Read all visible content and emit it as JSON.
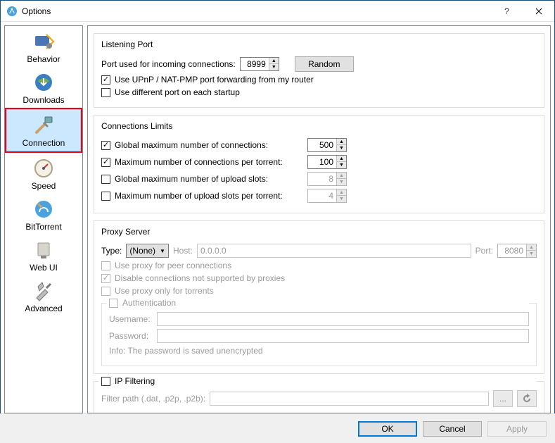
{
  "window": {
    "title": "Options"
  },
  "sidebar": {
    "items": [
      {
        "label": "Behavior"
      },
      {
        "label": "Downloads"
      },
      {
        "label": "Connection"
      },
      {
        "label": "Speed"
      },
      {
        "label": "BitTorrent"
      },
      {
        "label": "Web UI"
      },
      {
        "label": "Advanced"
      }
    ]
  },
  "listening_port": {
    "title": "Listening Port",
    "port_label": "Port used for incoming connections:",
    "port_value": "8999",
    "random_label": "Random",
    "upnp_label": "Use UPnP / NAT-PMP port forwarding from my router",
    "diffport_label": "Use different port on each startup"
  },
  "conn_limits": {
    "title": "Connections Limits",
    "global_max_label": "Global maximum number of connections:",
    "global_max_value": "500",
    "max_per_torrent_label": "Maximum number of connections per torrent:",
    "max_per_torrent_value": "100",
    "global_upload_label": "Global maximum number of upload slots:",
    "global_upload_value": "8",
    "upload_per_torrent_label": "Maximum number of upload slots per torrent:",
    "upload_per_torrent_value": "4"
  },
  "proxy": {
    "title": "Proxy Server",
    "type_label": "Type:",
    "type_value": "(None)",
    "host_label": "Host:",
    "host_value": "0.0.0.0",
    "port_label": "Port:",
    "port_value": "8080",
    "peer_label": "Use proxy for peer connections",
    "disable_unsupported_label": "Disable connections not supported by proxies",
    "only_torrents_label": "Use proxy only for torrents",
    "auth_title": "Authentication",
    "username_label": "Username:",
    "password_label": "Password:",
    "info_text": "Info: The password is saved unencrypted"
  },
  "ipfilter": {
    "title": "IP Filtering",
    "path_label": "Filter path (.dat, .p2p, .p2b):",
    "browse_label": "..."
  },
  "footer": {
    "ok": "OK",
    "cancel": "Cancel",
    "apply": "Apply"
  }
}
